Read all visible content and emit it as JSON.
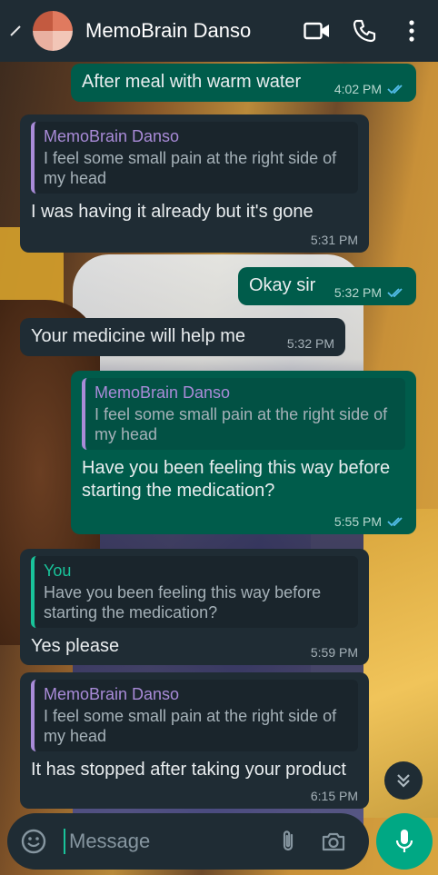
{
  "header": {
    "contact_name": "MemoBrain Danso",
    "icons": [
      "back-icon",
      "video-call-icon",
      "phone-icon",
      "menu-icon"
    ]
  },
  "messages": [
    {
      "direction": "out",
      "text": "After meal with warm water",
      "time": "4:02 PM",
      "read": true
    },
    {
      "direction": "in",
      "quote_name": "MemoBrain Danso",
      "quote_text": "I feel some small pain at the right side of my head",
      "text": "I was having it already but it's gone",
      "time": "5:31 PM"
    },
    {
      "direction": "out",
      "text": "Okay sir",
      "time": "5:32 PM",
      "read": true
    },
    {
      "direction": "in",
      "text": "Your medicine will help me",
      "time": "5:32 PM"
    },
    {
      "direction": "out",
      "quote_name": "MemoBrain Danso",
      "quote_text": "I feel some small pain at the right side of my head",
      "text": "Have you been feeling this way before starting the medication?",
      "time": "5:55 PM",
      "read": true
    },
    {
      "direction": "in",
      "quote_name": "You",
      "quote_text": "Have you been feeling this way before starting the medication?",
      "text": "Yes please",
      "time": "5:59 PM"
    },
    {
      "direction": "in",
      "quote_name": "MemoBrain Danso",
      "quote_text": "I feel some small pain at the right side of my head",
      "text": "It has stopped after taking your product",
      "time": "6:15 PM"
    }
  ],
  "composer": {
    "placeholder": "Message",
    "icons": [
      "emoji-icon",
      "attach-icon",
      "camera-icon",
      "mic-icon"
    ]
  },
  "colors": {
    "header_bg": "#1f2c34",
    "incoming_bubble": "#1f2c34",
    "outgoing_bubble": "#005c4b",
    "accent": "#00a884",
    "quote_name_other": "#a98bd8",
    "quote_name_you": "#19c39a",
    "read_ticks": "#53bdeb"
  }
}
